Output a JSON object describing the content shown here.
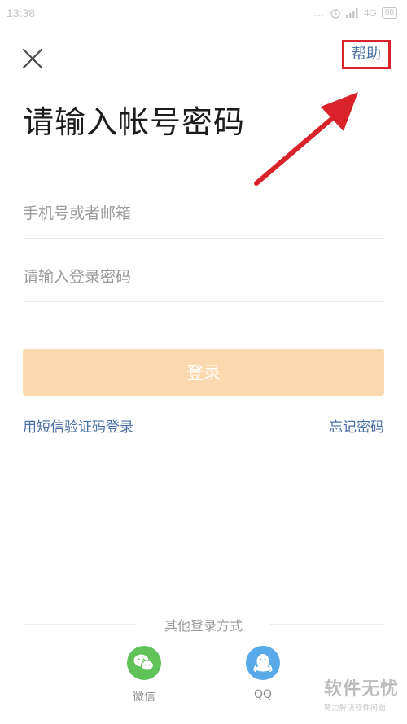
{
  "status_bar": {
    "time": "13:38",
    "dots": "...",
    "network": "4G",
    "battery": "66"
  },
  "header": {
    "help_label": "帮助"
  },
  "page": {
    "title": "请输入帐号密码"
  },
  "form": {
    "account_placeholder": "手机号或者邮箱",
    "password_placeholder": "请输入登录密码",
    "login_label": "登录"
  },
  "links": {
    "sms_login": "用短信验证码登录",
    "forgot_password": "忘记密码"
  },
  "other_login": {
    "title": "其他登录方式",
    "options": [
      {
        "label": "微信",
        "icon": "wechat-icon",
        "color": "#62c25a"
      },
      {
        "label": "QQ",
        "icon": "qq-icon",
        "color": "#58a9e8"
      }
    ]
  },
  "watermark": {
    "title": "软件无忧",
    "subtitle": "努力解决软件问题"
  },
  "colors": {
    "accent_link": "#4a6fa5",
    "login_button_disabled": "#fcd8ae",
    "annotation_red": "#d8232a"
  }
}
